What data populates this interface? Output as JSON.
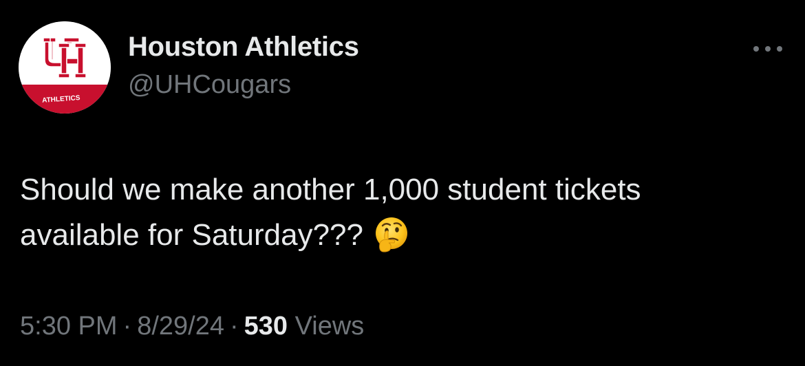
{
  "account": {
    "display_name": "Houston Athletics",
    "handle": "@UHCougars",
    "avatar": {
      "logo_text": "ATHLETICS",
      "logo_icon": "interlocking-UH-logo",
      "brand_color": "#c8102e"
    }
  },
  "more_icon": "ellipsis-icon",
  "tweet": {
    "lines": [
      "Should we make another 1,000 student tickets",
      "available for Saturday???"
    ],
    "emoji": "thinking-face-icon"
  },
  "meta": {
    "time": "5:30 PM",
    "date": "8/29/24",
    "separator": "·",
    "views_count": "530",
    "views_label": "Views"
  },
  "colors": {
    "background": "#000000",
    "primary_text": "#e7e9ea",
    "secondary_text": "#71767b"
  }
}
